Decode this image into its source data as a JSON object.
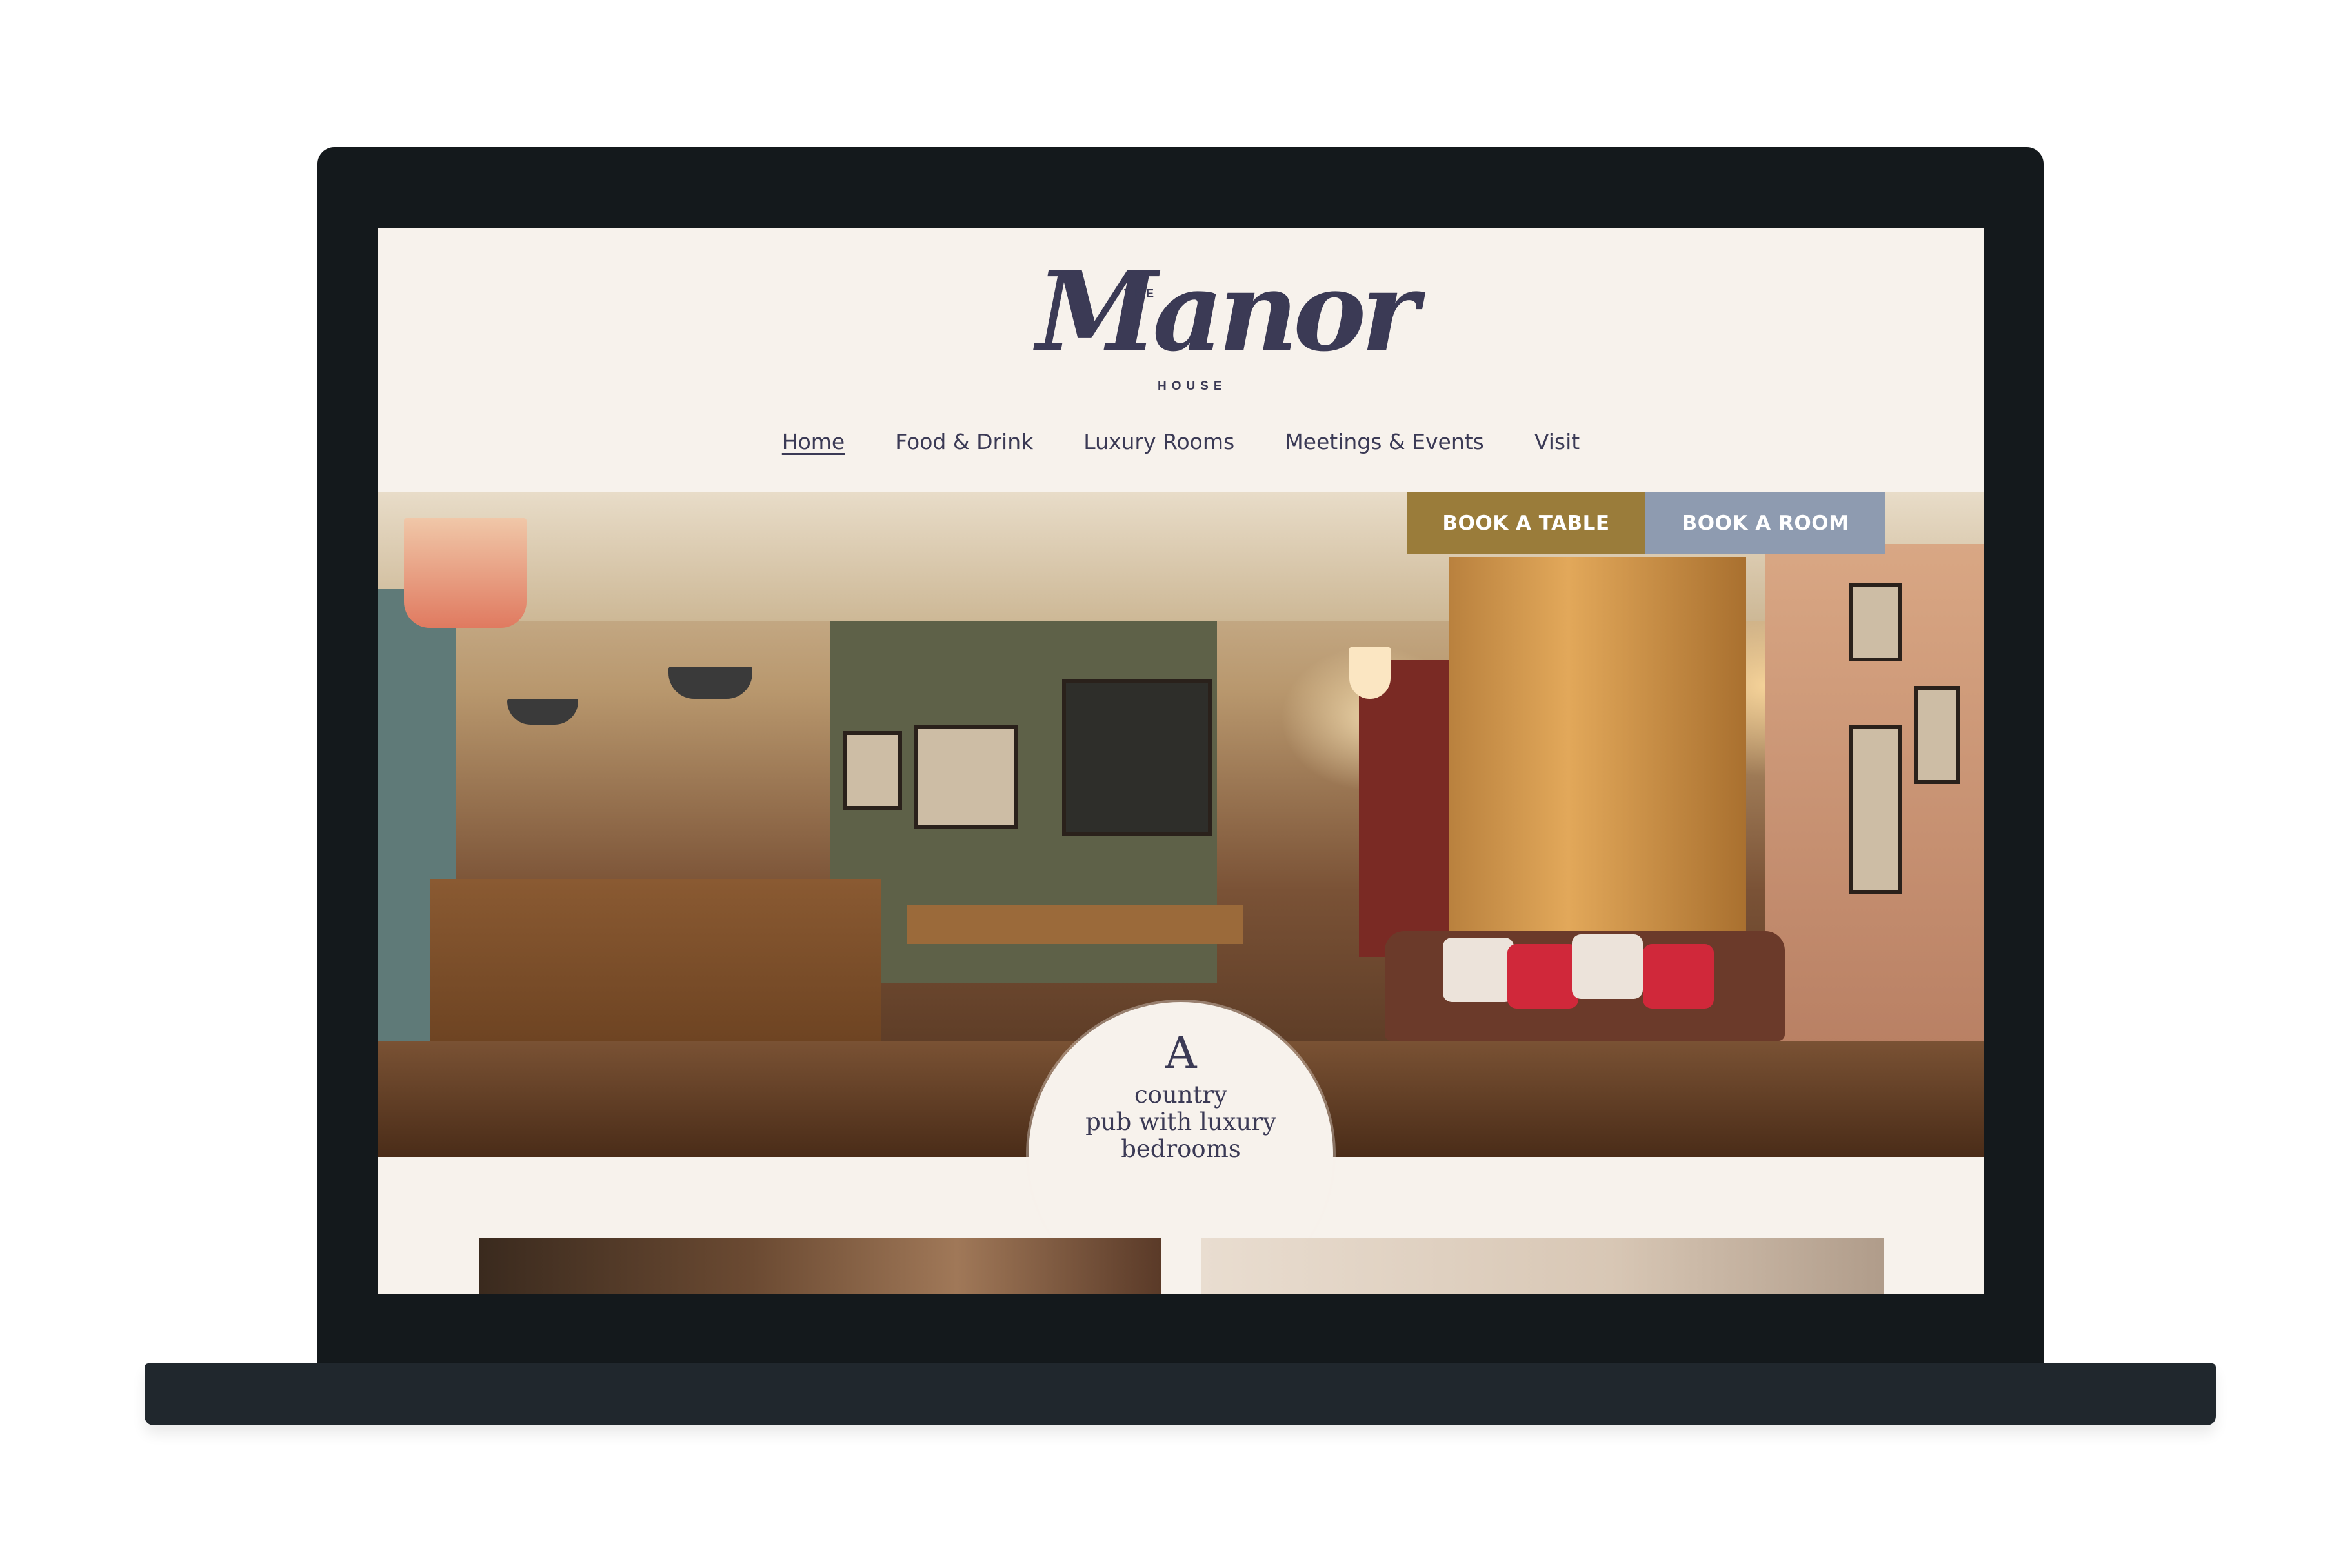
{
  "brand": {
    "the": "THE",
    "name": "Manor",
    "house": "HOUSE"
  },
  "nav": [
    {
      "label": "Home",
      "active": true
    },
    {
      "label": "Food & Drink",
      "active": false
    },
    {
      "label": "Luxury Rooms",
      "active": false
    },
    {
      "label": "Meetings & Events",
      "active": false
    },
    {
      "label": "Visit",
      "active": false
    }
  ],
  "cta": {
    "book_table": "BOOK A TABLE",
    "book_room": "BOOK A ROOM"
  },
  "tagline": {
    "line1": "A",
    "line2": "country",
    "line3": "pub with luxury",
    "line4": "bedrooms"
  },
  "colors": {
    "brand_navy": "#3b3a55",
    "gold": "#9a7c3a",
    "slate": "#8e9bb0",
    "cream": "#f7f2ec"
  }
}
